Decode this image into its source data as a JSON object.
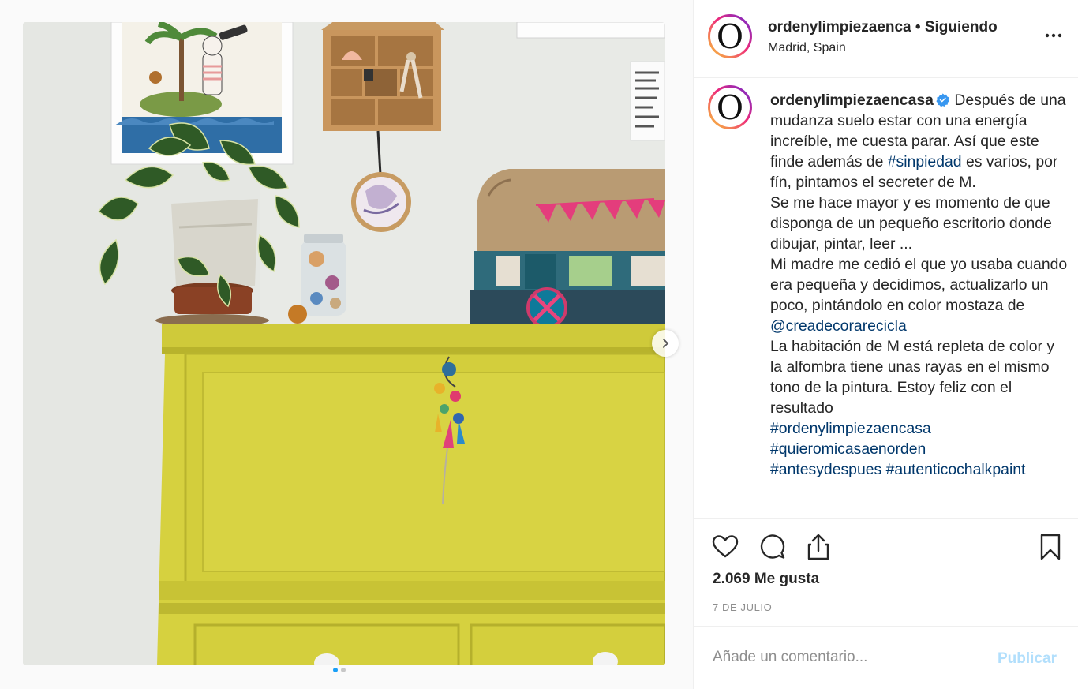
{
  "post": {
    "header": {
      "avatar_letter": "O",
      "username": "ordenylimpiezaenca",
      "separator": " • ",
      "follow_status": "Siguiendo",
      "location": "Madrid, Spain",
      "more_icon": "more-horizontal-icon"
    },
    "media": {
      "slide_count": 2,
      "active_slide": 1,
      "next_icon": "chevron-right-icon"
    },
    "caption": {
      "avatar_letter": "O",
      "username": "ordenylimpiezaencasa",
      "verified_icon": "verified-badge-icon",
      "p1_text1": " Después de una mudanza suelo estar con una energía increíble, me cuesta parar. Así que este finde además de ",
      "p1_tag": "#sinpiedad",
      "p1_text2": " es varios, por fín, pintamos el secreter de M.",
      "p2": "Se me hace mayor y es momento de que disponga de un pequeño escritorio donde dibujar, pintar, leer ...",
      "p3_text": "Mi madre me cedió el que yo usaba cuando era pequeña y decidimos, actualizarlo un poco, pintándolo en color mostaza de ",
      "p3_mention": "@creadecorarecicla",
      "p4": "La habitación de M está repleta de color y la alfombra tiene unas rayas en el mismo tono de la pintura. Estoy feliz con el resultado",
      "tag1": "#ordenylimpiezaencasa",
      "tag2": "#quieromicasaenorden",
      "tag3": "#antesydespues",
      "tag4": "#autenticochalkpaint"
    },
    "actions": {
      "like_icon": "heart-icon",
      "comment_icon": "comment-icon",
      "share_icon": "share-icon",
      "save_icon": "bookmark-icon"
    },
    "likes": "2.069 Me gusta",
    "date": "7 DE JULIO",
    "comment": {
      "placeholder": "Añade un comentario...",
      "post_label": "Publicar"
    }
  },
  "colors": {
    "accent_blue": "#0095f6",
    "link_blue": "#00376b",
    "publish_disabled": "#b2dffc",
    "muted_text": "#8e8e8e",
    "mustard": "#d4cf3c"
  }
}
